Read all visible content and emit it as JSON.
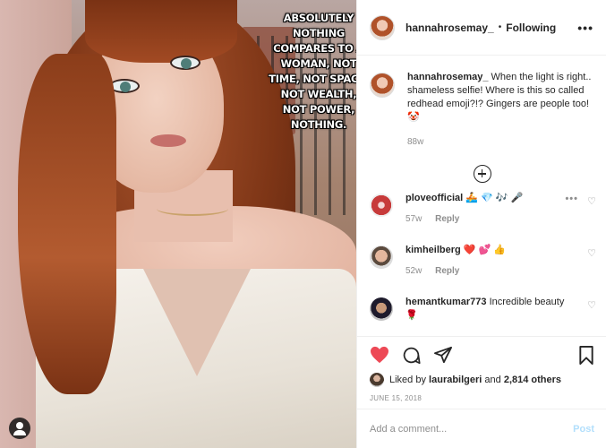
{
  "post": {
    "caption_overlay": "ABSOLUTELY NOTHING COMPARES TO A WOMAN, NOT TIME, NOT SPACE, NOT WEALTH, NOT POWER, NOTHING."
  },
  "header": {
    "username": "hannahrosemay_",
    "separator": "•",
    "follow_status": "Following",
    "more_icon": "more-horizontal-icon",
    "more_glyph": "•••"
  },
  "caption": {
    "username": "hannahrosemay_",
    "text": "When the light is right.. shameless selfie! Where is this so called redhead emoji?!? Gingers are people too! 🤡",
    "time": "88w"
  },
  "comments": [
    {
      "username": "plovеofficial",
      "text": "🚣 💎 🎶 🎤",
      "time": "57w",
      "reply": "Reply"
    },
    {
      "username": "kimheilberg",
      "text": "❤️ 💕 👍",
      "time": "52w",
      "reply": "Reply"
    },
    {
      "username": "hemantkumar773",
      "text": "Incredible beauty 🌹",
      "time": "",
      "reply": ""
    }
  ],
  "actions": {
    "like_icon": "heart-filled-icon",
    "comment_icon": "comment-icon",
    "share_icon": "share-icon",
    "save_icon": "bookmark-icon",
    "liked_by_prefix": "Liked by",
    "liked_by_user": "laurabilgeri",
    "liked_by_and": "and",
    "liked_by_count": "2,814 others",
    "date": "JUNE 15, 2018"
  },
  "add_comment": {
    "placeholder": "Add a comment...",
    "post_label": "Post"
  },
  "colors": {
    "like_red": "#ed4956",
    "post_disabled": "#b2dffc",
    "muted": "#8e8e8e"
  }
}
